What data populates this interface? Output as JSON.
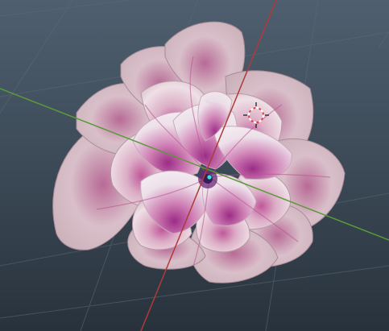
{
  "viewport": {
    "mode": "3d-viewport",
    "object": "flower-mesh",
    "colors": {
      "background_top": "#4f5f6f",
      "background_bottom": "#28323c",
      "grid_line": "#5b6a78",
      "x_axis": "#b03a3a",
      "y_axis": "#5a9a3a",
      "petal_base": "#e8d4dc",
      "petal_vein": "#b8508e",
      "center": "#3a1a5a",
      "origin_point": "#40e0e0",
      "cursor_red": "#e04040",
      "cursor_white": "#ffffff"
    }
  }
}
